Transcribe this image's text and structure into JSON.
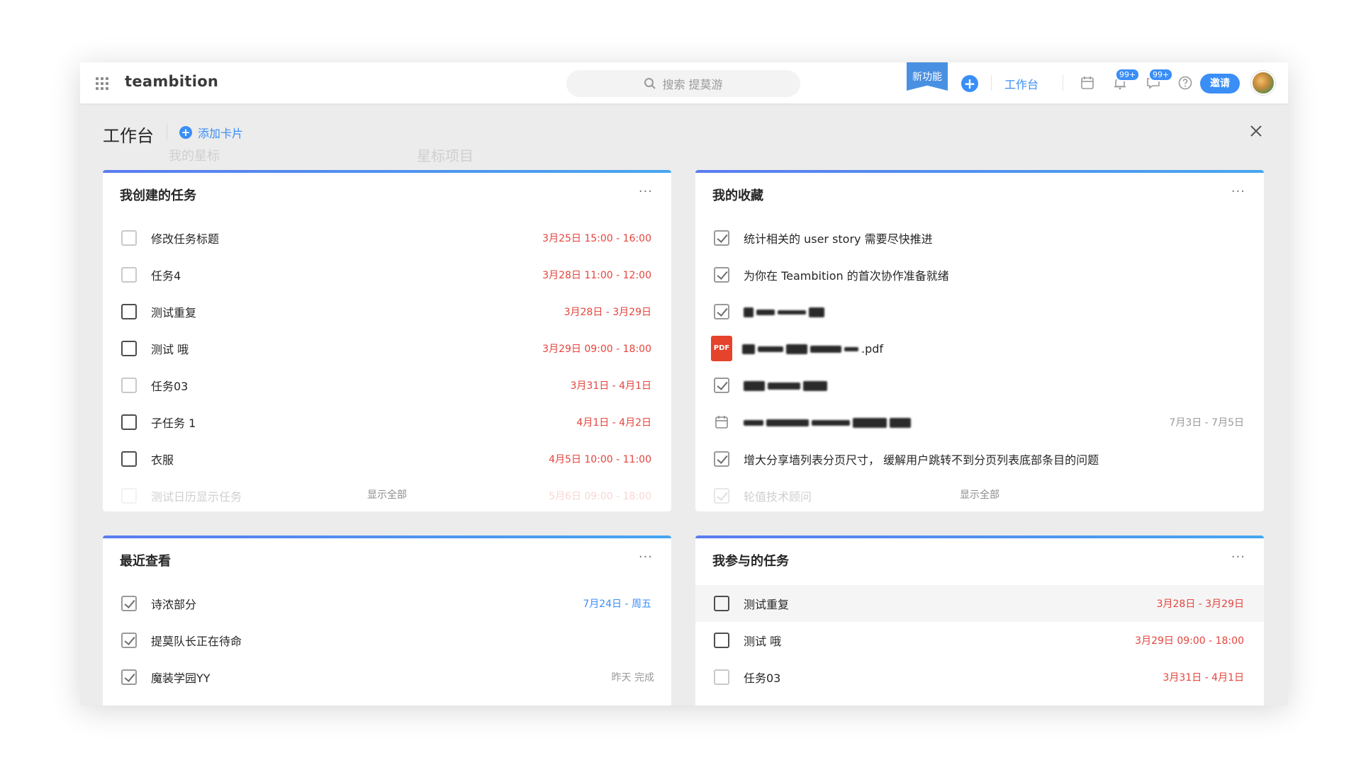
{
  "topbar": {
    "brand": "teambition",
    "search_placeholder": "搜索 提莫游",
    "new_feature": "新功能",
    "workbench": "工作台",
    "badge_notifications": "99+",
    "badge_messages": "99+",
    "invite": "邀请"
  },
  "panel": {
    "title": "工作台",
    "add_card": "添加卡片",
    "ghost_starred": "我的星标",
    "ghost_projects": "星标项目"
  },
  "cards": {
    "created": {
      "title": "我创建的任务",
      "more": "···",
      "show_all": "显示全部",
      "rows": [
        {
          "text": "修改任务标题",
          "meta": "3月25日 15:00 - 16:00"
        },
        {
          "text": "任务4",
          "meta": "3月28日 11:00 - 12:00"
        },
        {
          "text": "测试重复",
          "meta": "3月28日 - 3月29日"
        },
        {
          "text": "测试 哦",
          "meta": "3月29日 09:00 - 18:00"
        },
        {
          "text": "任务03",
          "meta": "3月31日 - 4月1日"
        },
        {
          "text": "子任务 1",
          "meta": "4月1日 - 4月2日"
        },
        {
          "text": "衣服",
          "meta": "4月5日 10:00 - 11:00"
        },
        {
          "text": "测试日历显示任务",
          "meta": "5月6日 09:00 - 18:00"
        }
      ]
    },
    "favorites": {
      "title": "我的收藏",
      "more": "···",
      "show_all": "显示全部",
      "rows": [
        {
          "text": "统计相关的 user story 需要尽快推进"
        },
        {
          "text": "为你在 Teambition 的首次协作准备就绪"
        },
        {
          "text": ""
        },
        {
          "text": ".pdf",
          "icon": "PDF"
        },
        {
          "text": ""
        },
        {
          "text": "",
          "meta": "7月3日 - 7月5日"
        },
        {
          "text": "增大分享墙列表分页尺寸， 缓解用户跳转不到分页列表底部条目的问题"
        },
        {
          "text": "轮值技术顾问"
        }
      ]
    },
    "recent": {
      "title": "最近查看",
      "more": "···",
      "rows": [
        {
          "text": "诗浓部分",
          "meta": "7月24日 - 周五"
        },
        {
          "text": "提莫队长正在待命"
        },
        {
          "text": "魔装学园YY",
          "meta": "昨天 完成"
        }
      ]
    },
    "participating": {
      "title": "我参与的任务",
      "more": "···",
      "rows": [
        {
          "text": "测试重复",
          "meta": "3月28日 - 3月29日"
        },
        {
          "text": "测试 哦",
          "meta": "3月29日 09:00 - 18:00"
        },
        {
          "text": "任务03",
          "meta": "3月31日 - 4月1日"
        }
      ]
    }
  }
}
